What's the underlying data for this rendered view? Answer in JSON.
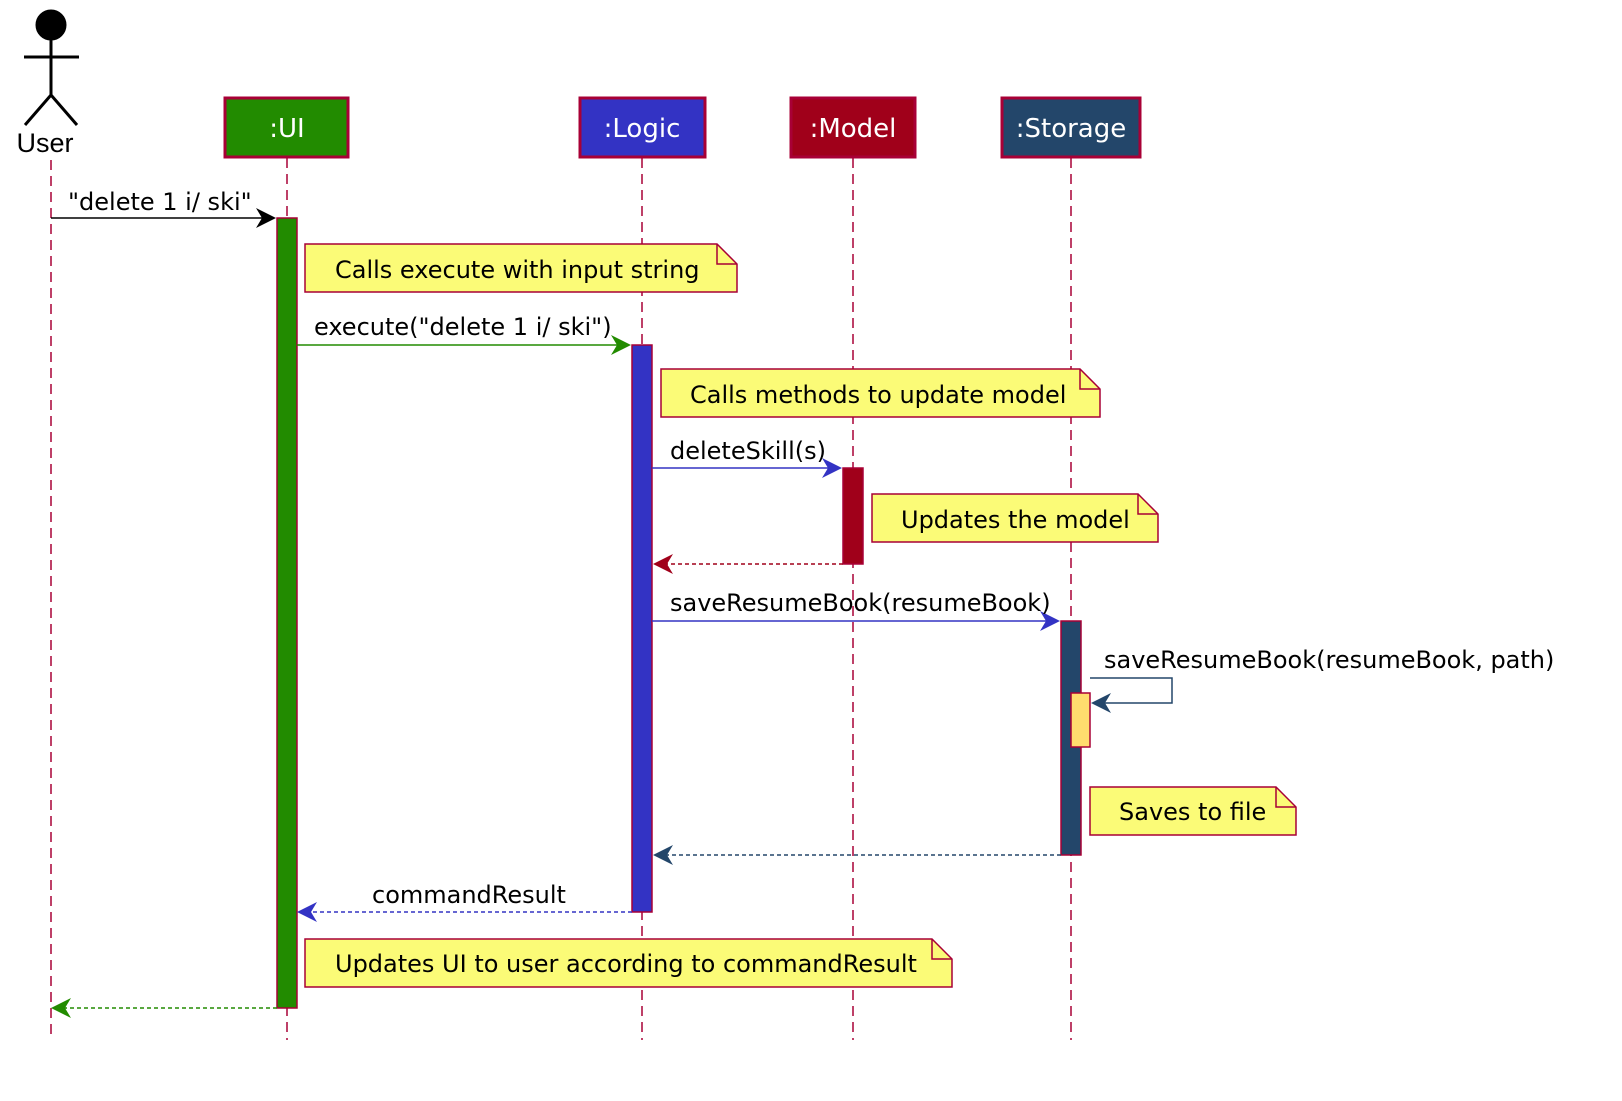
{
  "diagram": {
    "type": "sequence",
    "actor": {
      "id": "user",
      "label": "User"
    },
    "participants": [
      {
        "id": "ui",
        "label": ":UI",
        "fill": "#228B00",
        "activation": "#228B00"
      },
      {
        "id": "logic",
        "label": ":Logic",
        "fill": "#3333C4",
        "activation": "#3333C4"
      },
      {
        "id": "model",
        "label": ":Model",
        "fill": "#A0001A",
        "activation": "#A0001A"
      },
      {
        "id": "storage",
        "label": ":Storage",
        "fill": "#23466A",
        "activation": "#23466A"
      }
    ],
    "colors": {
      "border": "#A80036",
      "lifeline": "#A80036",
      "note_fill": "#FBFB77",
      "note_border": "#A80036",
      "nested_activation": "#FFDD6E",
      "user_arrow": "#000000"
    },
    "messages": [
      {
        "from": "user",
        "to": "ui",
        "label": "\"delete 1 i/ ski\"",
        "kind": "call",
        "color": "#000000"
      },
      {
        "note": "Calls execute with input string",
        "over": "ui"
      },
      {
        "from": "ui",
        "to": "logic",
        "label": "execute(\"delete 1 i/ ski\")",
        "kind": "call",
        "color": "#228B00"
      },
      {
        "note": "Calls methods to update model",
        "over": "logic"
      },
      {
        "from": "logic",
        "to": "model",
        "label": "deleteSkill(s)",
        "kind": "call",
        "color": "#3333C4"
      },
      {
        "note": "Updates the model",
        "over": "model"
      },
      {
        "from": "model",
        "to": "logic",
        "label": "",
        "kind": "return",
        "color": "#A0001A"
      },
      {
        "from": "logic",
        "to": "storage",
        "label": "saveResumeBook(resumeBook)",
        "kind": "call",
        "color": "#3333C4"
      },
      {
        "from": "storage",
        "to": "storage",
        "label": "saveResumeBook(resumeBook, path)",
        "kind": "self",
        "color": "#23466A"
      },
      {
        "note": "Saves to file",
        "over": "storage"
      },
      {
        "from": "storage",
        "to": "logic",
        "label": "",
        "kind": "return",
        "color": "#23466A"
      },
      {
        "from": "logic",
        "to": "ui",
        "label": "commandResult",
        "kind": "return",
        "color": "#3333C4"
      },
      {
        "note": "Updates UI to user according to commandResult",
        "over": "ui"
      },
      {
        "from": "ui",
        "to": "user",
        "label": "",
        "kind": "return",
        "color": "#228B00"
      }
    ]
  }
}
